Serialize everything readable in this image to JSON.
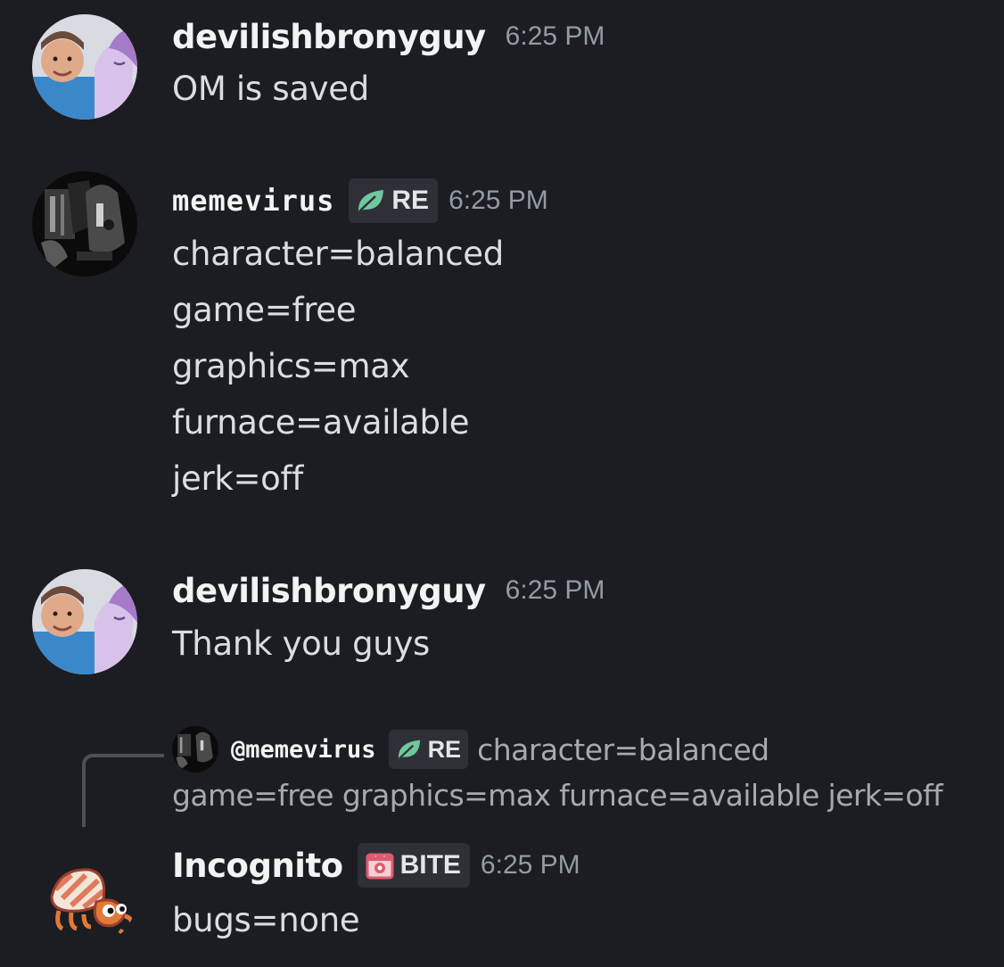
{
  "colors": {
    "background": "#1c1d22",
    "username": "#f2f3f5",
    "message_text": "#dbdee1",
    "timestamp": "#949ba4",
    "reply_text": "#a6a9b0",
    "tag_background": "#2f3037",
    "leaf_icon": "#6fc7a0",
    "bite_icon": "#e05a6d"
  },
  "messages": [
    {
      "username": "devilishbronyguy",
      "timestamp": "6:25 PM",
      "lines": [
        "OM is saved"
      ]
    },
    {
      "username": "memevirus",
      "tag": {
        "icon": "leaf-icon",
        "label": "RE"
      },
      "timestamp": "6:25 PM",
      "lines": [
        "character=balanced",
        "game=free",
        "graphics=max",
        "furnace=available",
        "jerk=off"
      ]
    },
    {
      "username": "devilishbronyguy",
      "timestamp": "6:25 PM",
      "lines": [
        "Thank you guys"
      ]
    },
    {
      "reply": {
        "mention": "@memevirus",
        "tag": {
          "icon": "leaf-icon",
          "label": "RE"
        },
        "preview_first": "character=balanced",
        "preview_second": "game=free graphics=max furnace=available jerk=off"
      },
      "username": "Incognito",
      "tag": {
        "icon": "bite-icon",
        "label": "BITE"
      },
      "timestamp": "6:25 PM",
      "lines": [
        "bugs=none"
      ]
    }
  ]
}
